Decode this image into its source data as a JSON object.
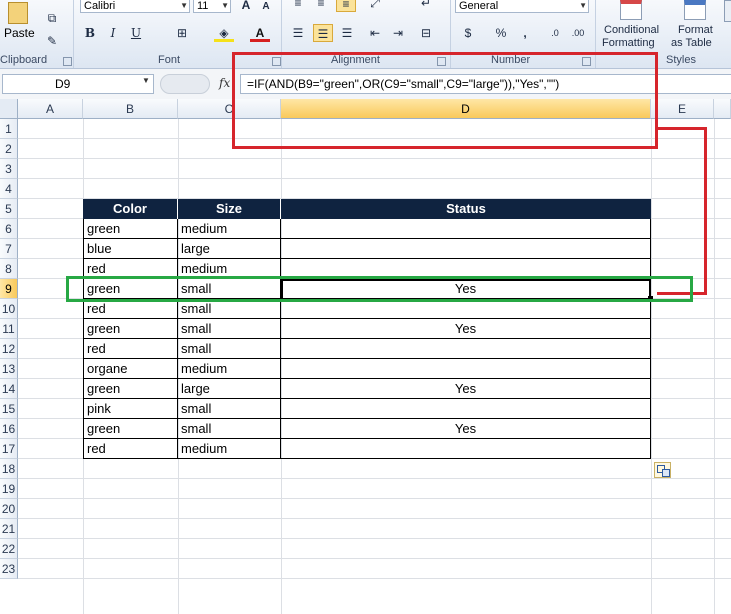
{
  "ribbon": {
    "paste_label": "Paste",
    "groups": {
      "clipboard": "Clipboard",
      "font": "Font",
      "alignment": "Alignment",
      "number": "Number",
      "styles": "Styles"
    },
    "font_name": "Calibri",
    "font_size": "11",
    "number_format": "General",
    "number_symbols": {
      "currency": "$",
      "percent": "%",
      "comma": ","
    },
    "conditional_formatting": [
      "Conditional",
      "Formatting"
    ],
    "format_as_table": [
      "Format",
      "as Table"
    ],
    "font_buttons": {
      "bold": "B",
      "italic": "I",
      "underline": "U",
      "grow": "A",
      "shrink": "A"
    }
  },
  "formula_bar": {
    "name_box": "D9",
    "fx": "fx",
    "formula": "=IF(AND(B9=\"green\",OR(C9=\"small\",C9=\"large\")),\"Yes\",\"\")"
  },
  "columns": [
    "A",
    "B",
    "C",
    "D",
    "E"
  ],
  "selected_column": "D",
  "selected_row": 9,
  "rows": [
    "1",
    "2",
    "3",
    "4",
    "5",
    "6",
    "7",
    "8",
    "9",
    "10",
    "11",
    "12",
    "13",
    "14",
    "15",
    "16",
    "17",
    "18",
    "19",
    "20",
    "21",
    "22",
    "23"
  ],
  "table": {
    "headers": [
      "Color",
      "Size",
      "Status"
    ],
    "rows": [
      [
        "green",
        "medium",
        ""
      ],
      [
        "blue",
        "large",
        ""
      ],
      [
        "red",
        "medium",
        ""
      ],
      [
        "green",
        "small",
        "Yes"
      ],
      [
        "red",
        "small",
        ""
      ],
      [
        "green",
        "small",
        "Yes"
      ],
      [
        "red",
        "small",
        ""
      ],
      [
        "organe",
        "medium",
        ""
      ],
      [
        "green",
        "large",
        "Yes"
      ],
      [
        "pink",
        "small",
        ""
      ],
      [
        "green",
        "small",
        "Yes"
      ],
      [
        "red",
        "medium",
        ""
      ]
    ]
  },
  "colors": {
    "header_fill": "#0f2340",
    "annotation_red": "#d6252c",
    "annotation_green": "#27a844",
    "selection": "#f9c95b"
  }
}
